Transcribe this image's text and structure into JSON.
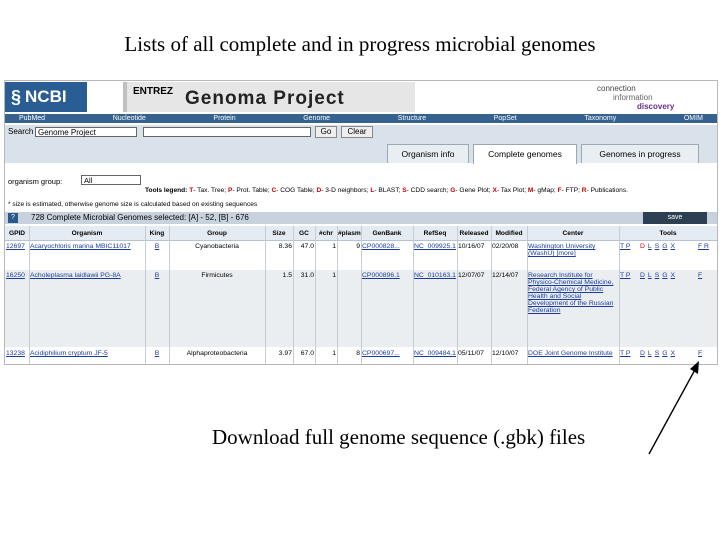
{
  "slide": {
    "title": "Lists of all complete and in progress microbial genomes",
    "caption": "Download full genome sequence (.gbk) files"
  },
  "header": {
    "logo_text": "NCBI",
    "entrez": "ENTREZ",
    "title": "Genoma Project",
    "tagline": [
      "connection",
      "information",
      "discovery"
    ]
  },
  "nav": [
    "PubMed",
    "Nucleotide",
    "Protein",
    "Genome",
    "Structure",
    "PopSet",
    "Taxonomy",
    "OMIM"
  ],
  "search": {
    "label": "Search",
    "db": "Genome Project",
    "query": "",
    "go": "Go",
    "clear": "Clear"
  },
  "tabs": [
    "Organism info",
    "Complete genomes",
    "Genomes in progress"
  ],
  "organism_group": {
    "label": "organism group:",
    "value": "All"
  },
  "tools_legend": {
    "prefix": "Tools legend:",
    "items": [
      {
        "key": "T",
        "text": "- Tax. Tree;"
      },
      {
        "key": "P",
        "text": "- Prot. Table;"
      },
      {
        "key": "C",
        "text": "- COG Table;"
      },
      {
        "key": "D",
        "text": "- 3-D neighbors;"
      },
      {
        "key": "L",
        "text": "- BLAST;"
      },
      {
        "key": "S",
        "text": "- CDD search;"
      },
      {
        "key": "G",
        "text": "- Gene Plot;"
      },
      {
        "key": "X",
        "text": "- Tax Plot;"
      },
      {
        "key": "M",
        "text": "- gMap;"
      },
      {
        "key": "F",
        "text": "- FTP;"
      },
      {
        "key": "R",
        "text": "- Publications."
      }
    ]
  },
  "size_note": "* size is estimated, otherwise genome size is calculated based on existing sequences",
  "summary": {
    "help": "?",
    "text": "728 Complete Microbial Genomes selected: [A] - 52, [B] - 676",
    "save": "save"
  },
  "table": {
    "columns": [
      "GPID",
      "Organism",
      "King",
      "Group",
      "Size",
      "GC",
      "#chr",
      "#plasm",
      "GenBank",
      "RefSeq",
      "Released",
      "Modified",
      "Center",
      "Tools"
    ],
    "rows": [
      {
        "gpid": "12697",
        "organism": "Acaryochloris marina MBIC11017",
        "king": "B",
        "group": "Cyanobacteria",
        "size": "8.36",
        "gc": "47.0",
        "chr": "1",
        "plasm": "9",
        "genbank": "CP000828...",
        "refseq": "NC_009925.1",
        "released": "10/16/07",
        "modified": "02/20/08",
        "center": "Washington University (WashU) [more]",
        "link1": "T P",
        "tools": [
          "D",
          "L",
          "S",
          "G",
          "X"
        ],
        "ext": "F R"
      },
      {
        "gpid": "16250",
        "organism": "Acholeplasma laidlawii PG-8A",
        "king": "B",
        "group": "Firmicutes",
        "size": "1.5",
        "gc": "31.0",
        "chr": "1",
        "plasm": "",
        "genbank": "CP000896.1",
        "refseq": "NC_010163.1",
        "released": "12/07/07",
        "modified": "12/14/07",
        "center": "Research Institute for Physico-Chemical Medicine, Federal Agency of Public Health and Social Development of the Russian Federation",
        "link1": "T P",
        "tools": [
          "D",
          "L",
          "S",
          "G",
          "X"
        ],
        "ext": "F"
      },
      {
        "gpid": "13238",
        "organism": "Acidiphilium cryptum JF-5",
        "king": "B",
        "group": "Alphaproteobacteria",
        "size": "3.97",
        "gc": "67.0",
        "chr": "1",
        "plasm": "8",
        "genbank": "CP000697...",
        "refseq": "NC_009484.1",
        "released": "05/11/07",
        "modified": "12/10/07",
        "center": "DOE Joint Genome Institute",
        "link1": "T P",
        "tools": [
          "D",
          "L",
          "S",
          "G",
          "X"
        ],
        "ext": "F"
      }
    ]
  },
  "colors": {
    "ncbi_blue": "#2a5d93",
    "nav_bar": "#35628f",
    "link": "#1a3c9c",
    "legend_key": "#c00000"
  }
}
